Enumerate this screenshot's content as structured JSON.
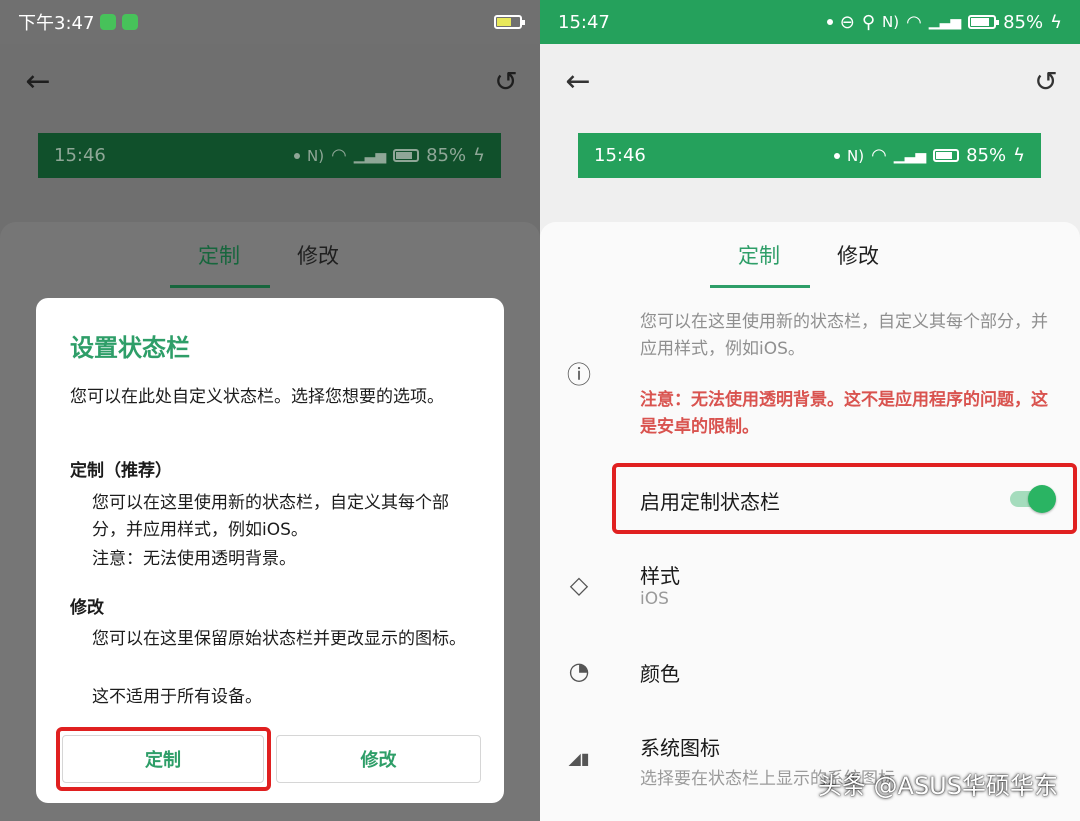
{
  "left": {
    "status_bar": {
      "time": "下午3:47"
    },
    "preview_bar": {
      "time": "15:46",
      "battery": "85%"
    },
    "tabs": [
      {
        "label": "定制"
      },
      {
        "label": "修改"
      }
    ],
    "dialog": {
      "title": "设置状态栏",
      "intro": "您可以在此处自定义状态栏。选择您想要的选项。",
      "custom_heading": "定制（推荐）",
      "custom_desc": "您可以在这里使用新的状态栏，自定义其每个部分，并应用样式，例如iOS。",
      "custom_note": "注意：无法使用透明背景。",
      "modify_heading": "修改",
      "modify_desc": "您可以在这里保留原始状态栏并更改显示的图标。",
      "modify_note": "这不适用于所有设备。",
      "btn_custom": "定制",
      "btn_modify": "修改"
    }
  },
  "right": {
    "status_bar": {
      "time": "15:47",
      "battery": "85%"
    },
    "preview_bar": {
      "time": "15:46",
      "battery": "85%"
    },
    "tabs": [
      {
        "label": "定制"
      },
      {
        "label": "修改"
      }
    ],
    "info": "您可以在这里使用新的状态栏，自定义其每个部分，并应用样式，例如iOS。",
    "warning": "注意：无法使用透明背景。这不是应用程序的问题，这是安卓的限制。",
    "enable_label": "启用定制状态栏",
    "enable_on": true,
    "style_label": "样式",
    "style_value": "iOS",
    "color_label": "颜色",
    "system_icons_label": "系统图标",
    "system_icons_desc": "选择要在状态栏上显示的系统图标"
  },
  "watermark": "头条 @ASUS华硕华东",
  "colors": {
    "accent": "#2e9e68",
    "statusbar_green": "#25a15c",
    "warning": "#d9534f",
    "highlight": "#e02020"
  }
}
